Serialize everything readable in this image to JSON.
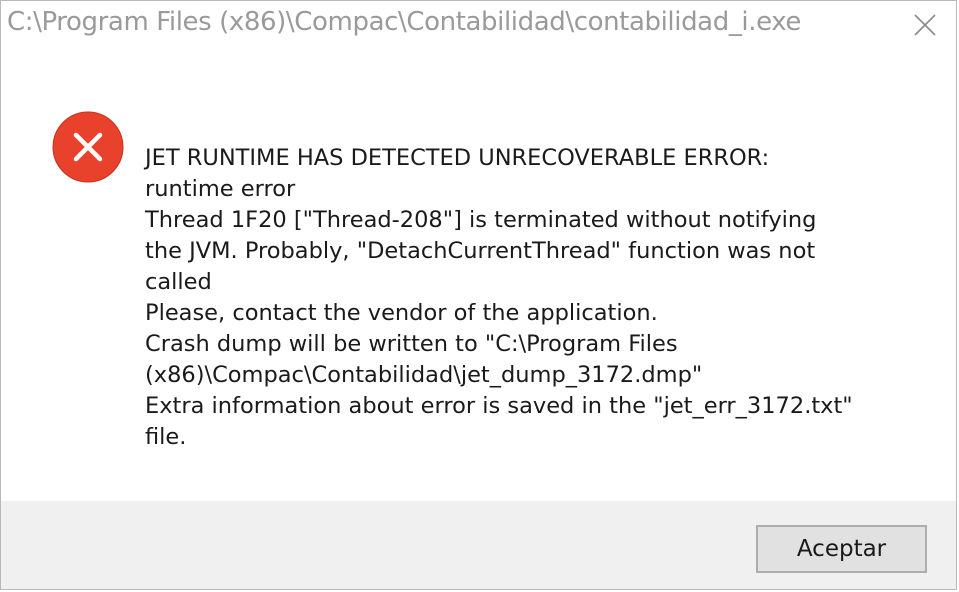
{
  "window": {
    "title": "C:\\Program Files (x86)\\Compac\\Contabilidad\\contabilidad_i.exe"
  },
  "icons": {
    "close": "close-icon",
    "error": "error-icon"
  },
  "message": {
    "lines": [
      "JET RUNTIME HAS DETECTED UNRECOVERABLE ERROR:",
      "runtime error",
      "Thread 1F20 [\"Thread-208\"] is terminated without notifying",
      "the JVM. Probably, \"DetachCurrentThread\" function was not",
      "called",
      "Please, contact the vendor of the application.",
      "Crash dump will be written to \"C:\\Program Files",
      "(x86)\\Compac\\Contabilidad\\jet_dump_3172.dmp\"",
      "Extra information about error is saved in the \"jet_err_3172.txt\"",
      "file."
    ]
  },
  "buttons": {
    "ok_label": "Aceptar"
  },
  "colors": {
    "error_red": "#e8412c",
    "footer_bg": "#f0f0f0",
    "title_text": "#9a9a9a"
  }
}
